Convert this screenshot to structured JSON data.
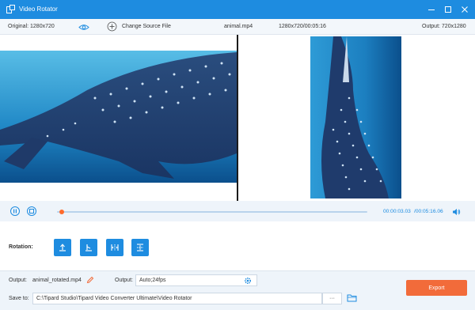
{
  "window": {
    "title": "Video Rotator",
    "colors": {
      "titlebar": "#1e8ce0",
      "accent": "#1e8ce0",
      "export": "#f26b3a",
      "progress_thumb": "#ff6b2c"
    }
  },
  "infobar": {
    "original": "Original: 1280x720",
    "change_source": "Change Source File",
    "filename": "animal.mp4",
    "meta": "1280x720/00:05:16",
    "output": "Output: 720x1280"
  },
  "preview": {
    "left_icon": "whale-shark-original-frame",
    "right_icon": "whale-shark-rotated-frame"
  },
  "playback": {
    "current_time": "00:00:03.03",
    "total_time": "/00:05:16.06",
    "progress_fraction": 0.01
  },
  "rotation": {
    "label": "Rotation:",
    "buttons": [
      {
        "name": "rotate-left-button",
        "icon": "rotate-left-icon"
      },
      {
        "name": "rotate-right-button",
        "icon": "rotate-right-icon"
      },
      {
        "name": "flip-horizontal-button",
        "icon": "flip-horizontal-icon"
      },
      {
        "name": "flip-vertical-button",
        "icon": "flip-vertical-icon"
      }
    ]
  },
  "footer": {
    "output_label": "Output:",
    "output_name": "animal_rotated.mp4",
    "format_label": "Output:",
    "format_value": "Auto;24fps",
    "save_label": "Save to:",
    "save_path": "C:\\Tipard Studio\\Tipard Video Converter Ultimate\\Video Rotator",
    "browse_label": "···",
    "export_label": "Export"
  }
}
